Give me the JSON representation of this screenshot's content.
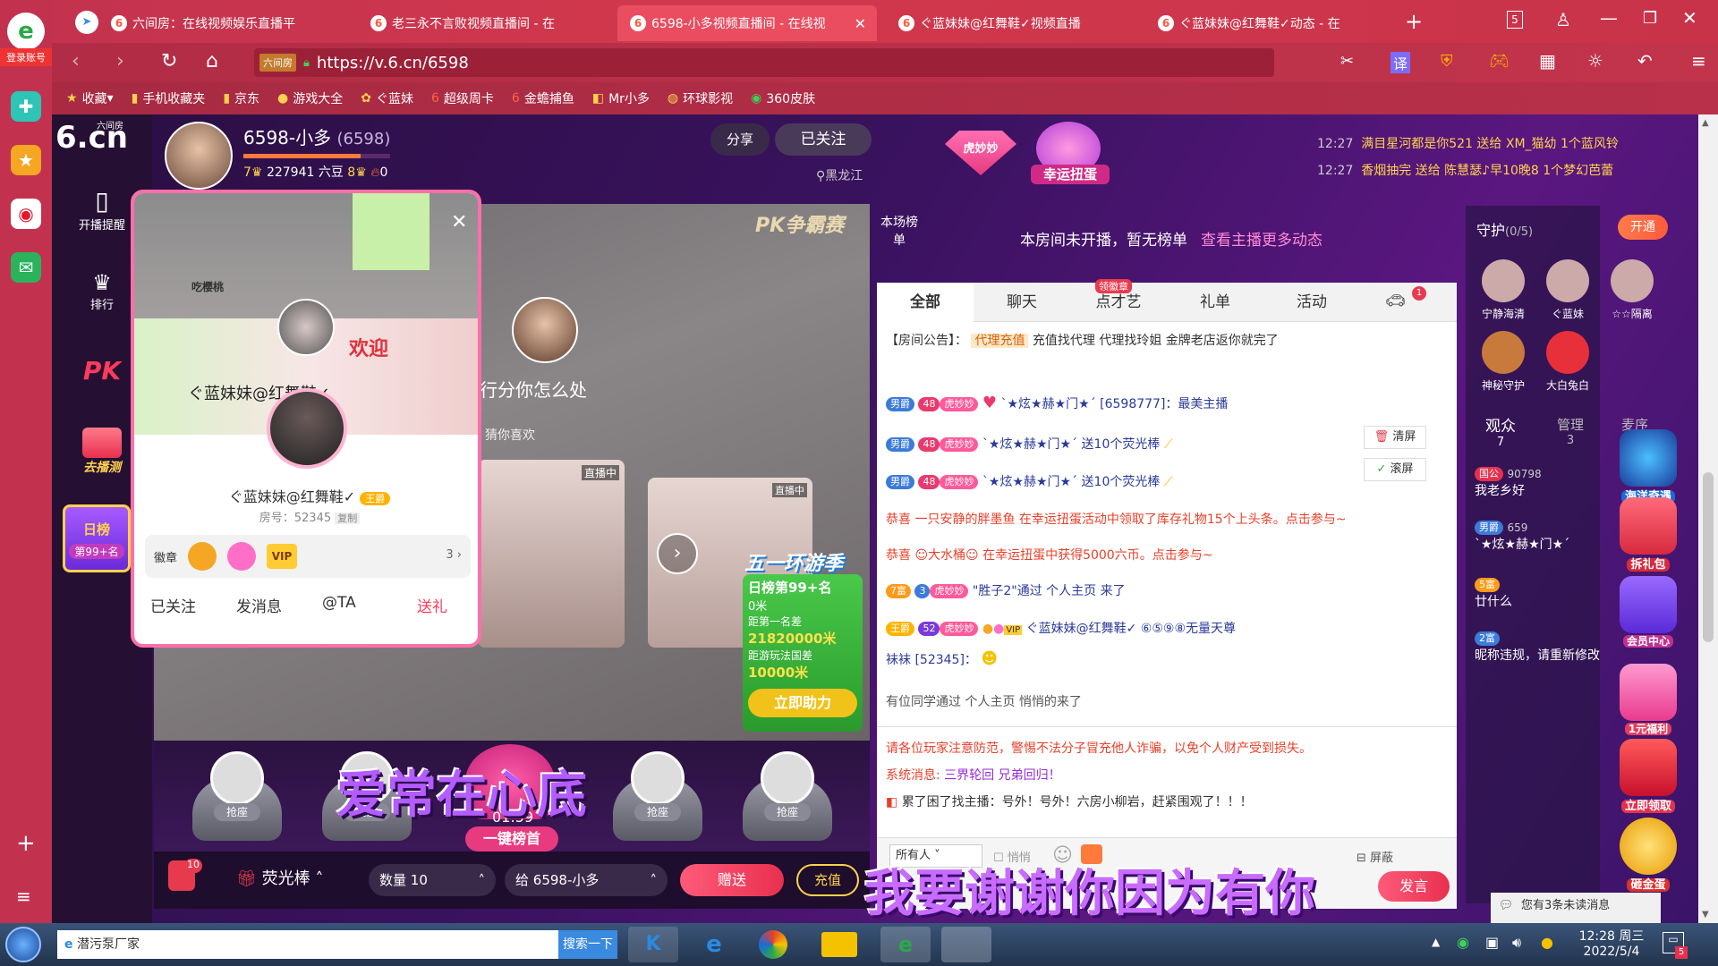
{
  "browser": {
    "login": "登录账号",
    "tabs": [
      {
        "title": "六间房：在线视频娱乐直播平"
      },
      {
        "title": "老三永不言败视频直播间 - 在"
      },
      {
        "title": "6598-小多视频直播间 - 在线视"
      },
      {
        "title": "ぐ蓝妹妹@红舞鞋✓视频直播"
      },
      {
        "title": "ぐ蓝妹妹@红舞鞋✓动态 - 在"
      }
    ],
    "tab_count": "5",
    "url_tag": "六间房",
    "url": "https://v.6.cn/6598",
    "translate": "译",
    "bookmarks": [
      "收藏",
      "手机收藏夹",
      "京东",
      "游戏大全",
      "ぐ蓝妹",
      "超级周卡",
      "金蟾捕鱼",
      "Mr小多",
      "环球影视",
      "360皮肤"
    ]
  },
  "site": {
    "logo_main": "6.cn",
    "logo_sub": "六间房",
    "nav": [
      {
        "label": "开播提醒",
        "icon": "phone-icon"
      },
      {
        "label": "排行",
        "icon": "crown-icon"
      },
      {
        "label": "PK",
        "icon": "pk-icon"
      },
      {
        "label": "去播测",
        "icon": "gift-icon"
      }
    ],
    "daily_rank": {
      "title": "日榜",
      "rank": "第99+名"
    }
  },
  "anchor": {
    "name": "6598-小多",
    "id": "(6598)",
    "level": "7",
    "beans": "227941 六豆",
    "rich_level": "8",
    "fans": "0",
    "location": "黑龙江",
    "share": "分享",
    "followed": "已关注"
  },
  "popup": {
    "name": "ぐ蓝妹妹@红舞鞋✓",
    "title_badge": "王爵",
    "room_no": "房号：52345",
    "copy": "复制",
    "medal_label": "徽章",
    "medal_count": "3",
    "actions": [
      "已关注",
      "发消息",
      "@TA",
      "送礼"
    ],
    "sticker_text": "吃樱桃",
    "welcome": "欢迎"
  },
  "video": {
    "pk_logo": "PK争霸赛",
    "caption": "行分你怎么处",
    "guess": "猜你喜欢",
    "live1": "直播中",
    "live2": "直播中",
    "promo": {
      "title": "五一环游季",
      "rank_line1": "日榜第99+名",
      "rank_line2": "0米",
      "gap_label": "距第一名差",
      "gap_value": "21820000米",
      "goal_label": "距游玩法国差",
      "goal_value": "10000米",
      "button": "立即助力"
    }
  },
  "seats": {
    "label": "抢座",
    "center_timer": "01:59",
    "center_button": "一键榜首",
    "overlay": "爱常在心底"
  },
  "gift_bar": {
    "count_badge": "10",
    "gift_name": "荧光棒",
    "qty_label": "数量",
    "qty": "10",
    "to_label": "给",
    "to_name": "6598-小多",
    "send": "赠送",
    "recharge": "充值",
    "overlay": "我要谢谢你因为有你"
  },
  "top_area": {
    "tiger": "虎妙妙",
    "lucky": "幸运扭蛋",
    "feed": [
      {
        "time": "12:27",
        "text": "满目星河都是你521 送给 XM_猫幼 1个蓝风铃"
      },
      {
        "time": "12:27",
        "text": "香烟抽完 送给 陈慧瑟♪早10晚8 1个梦幻芭蕾"
      }
    ]
  },
  "ranking": {
    "label": "本场榜单",
    "empty_text": "本房间未开播，暂无榜单",
    "link": "查看主播更多动态"
  },
  "chat": {
    "tabs": [
      "全部",
      "聊天",
      "点才艺",
      "礼单",
      "活动"
    ],
    "badge_tab": "领徽章",
    "car_count": "1",
    "notice_label": "【房间公告】：",
    "notice_tag": "代理充值",
    "notice_text": "充值找代理 代理找玲姐 金牌老店返你就完了",
    "clear": "清屏",
    "scroll": "滚屏",
    "messages": [
      {
        "badge": "男爵",
        "lv": "48",
        "tag": "虎妙妙",
        "text": "`★炫★赫★门★´ [6598777]：最美主播"
      },
      {
        "badge": "男爵",
        "lv": "48",
        "tag": "虎妙妙",
        "text": "`★炫★赫★门★´ 送10个荧光棒"
      },
      {
        "badge": "男爵",
        "lv": "48",
        "tag": "虎妙妙",
        "text": "`★炫★赫★门★´ 送10个荧光棒"
      },
      {
        "text": "恭喜 一只安静的胖墨鱼 在幸运扭蛋活动中领取了库存礼物15个上头条。点击参与~"
      },
      {
        "text": "恭喜 ☺大水桶☺ 在幸运扭蛋中获得5000六币。点击参与~"
      },
      {
        "badge": "7富",
        "lv": "3",
        "tag": "虎妙妙",
        "text": "\"胜子2\"通过 个人主页 来了"
      },
      {
        "badge": "王爵",
        "lv": "52",
        "tag": "虎妙妙",
        "text": "ぐ蓝妹妹@红舞鞋✓ ⑥⑤⑨⑧无量天尊"
      },
      {
        "text": "袜袜 [52345]："
      },
      {
        "text": "有位同学通过 个人主页 悄悄的来了"
      }
    ],
    "warning": "请各位玩家注意防范，警惕不法分子冒充他人诈骗，以免个人财产受到损失。",
    "system_label": "系统消息:",
    "system_text": "三界轮回 兄弟回归！",
    "promo_line": "累了困了找主播：号外！号外！六房小柳岩，赶紧围观了！！！",
    "target": "所有人",
    "whisper": "悄悄",
    "shield": "屏蔽",
    "send": "发言"
  },
  "guards": {
    "title": "守护",
    "count": "(0/5)",
    "open": "开通",
    "list": [
      "宁静海清",
      "ぐ蓝妹",
      "☆☆隔离",
      "神秘守护",
      "大白兔白"
    ]
  },
  "audience": {
    "tabs": [
      {
        "label": "观众",
        "n": "7"
      },
      {
        "label": "管理",
        "n": "3"
      },
      {
        "label": "麦序",
        "n": ""
      }
    ],
    "list": [
      {
        "badge": "国公",
        "name": "我老乡好",
        "score": "90798"
      },
      {
        "badge": "男爵",
        "name": "`★炫★赫★门★´",
        "score": "659"
      },
      {
        "badge": "5富",
        "name": "廿什么",
        "score": ""
      },
      {
        "badge": "2富",
        "name": "昵称违规，请重新修改",
        "score": ""
      }
    ],
    "unread": "您有3条未读消息"
  },
  "right_side": [
    "海洋奇遇",
    "拆礼包",
    "会员中心",
    "1元福利",
    "立即领取",
    "砸金蛋"
  ],
  "taskbar": {
    "search_text": "潜污泵厂家",
    "search_btn": "搜索一下",
    "time": "12:28 周三",
    "date": "2022/5/4",
    "notif": "5"
  }
}
